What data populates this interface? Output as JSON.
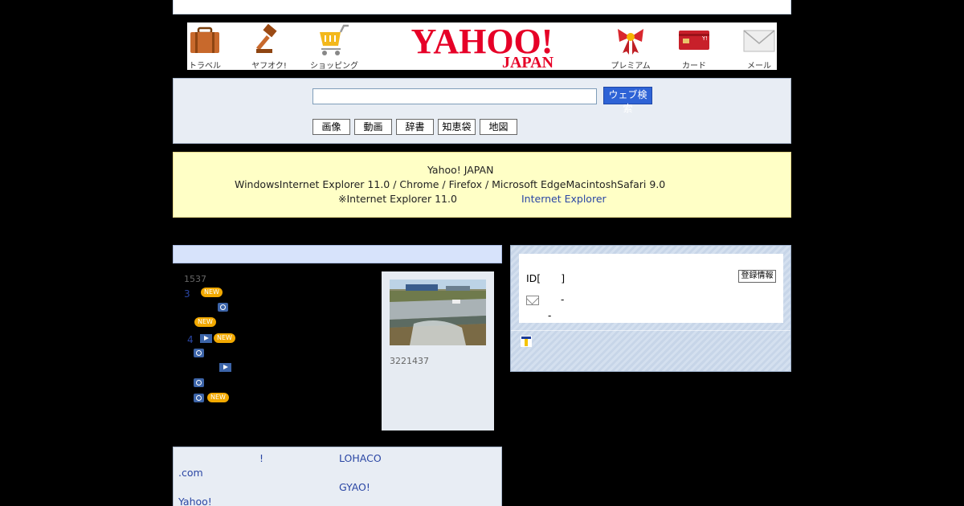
{
  "masthead": {
    "left_items": [
      {
        "label": "トラベル",
        "icon": "suitcase-icon"
      },
      {
        "label": "ヤフオク!",
        "icon": "auction-gavel-icon"
      },
      {
        "label": "ショッピング",
        "icon": "shopping-cart-icon"
      }
    ],
    "right_items": [
      {
        "label": "プレミアム",
        "icon": "premium-ribbon-icon"
      },
      {
        "label": "カード",
        "icon": "credit-card-icon"
      },
      {
        "label": "メール",
        "icon": "mail-envelope-icon"
      }
    ],
    "logo_main": "YAHOO!",
    "logo_sub": "JAPAN"
  },
  "search": {
    "query": "",
    "button_label": "ウェブ検索",
    "categories": [
      "画像",
      "動画",
      "辞書",
      "知恵袋",
      "地図"
    ]
  },
  "notice": {
    "line1": "Yahoo! JAPAN",
    "line2": "WindowsInternet Explorer 11.0 / Chrome  / Firefox  / Microsoft EdgeMacintoshSafari 9.0",
    "line3": "※Internet Explorer 11.0",
    "link": "Internet Explorer"
  },
  "news": {
    "count_label": "1537",
    "rank_3": "3",
    "rank_4": "4",
    "badge_label": "NEW"
  },
  "photo_card": {
    "caption": "3221437"
  },
  "promo": {
    "exclaim": "!",
    "lohaco": "LOHACO",
    "dotcom": ".com",
    "gyao": "GYAO!",
    "yahoo": "Yahoo!"
  },
  "login": {
    "id_label": "ID[　　]",
    "register_label": "登録情報",
    "dash": "-"
  },
  "colors": {
    "yahoo_red": "#e60027",
    "link_blue": "#2a46a4",
    "search_button": "#2e63d6",
    "new_badge": "#f2a900"
  }
}
